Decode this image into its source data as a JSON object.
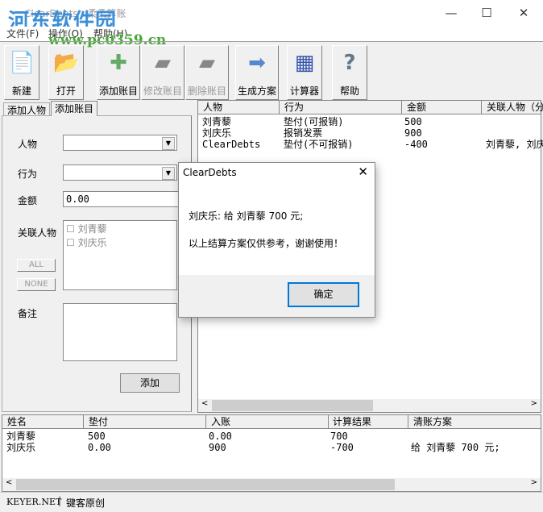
{
  "window": {
    "title": "ClearDebts - 柔柔算账",
    "watermark": "河东软件园",
    "watermark_url": "www.pc0359.cn"
  },
  "menu": [
    "文件(F)",
    "操作(O)",
    "帮助(H)"
  ],
  "toolbar": [
    {
      "label": "新建",
      "icon": "new-file-icon",
      "enabled": true
    },
    {
      "label": "打开",
      "icon": "open-folder-icon",
      "enabled": true
    },
    {
      "label": "添加账目",
      "icon": "add-entry-icon",
      "enabled": true
    },
    {
      "label": "修改账目",
      "icon": "edit-entry-icon",
      "enabled": false
    },
    {
      "label": "删除账目",
      "icon": "delete-entry-icon",
      "enabled": false
    },
    {
      "label": "生成方案",
      "icon": "generate-plan-icon",
      "enabled": true
    },
    {
      "label": "计算器",
      "icon": "calculator-icon",
      "enabled": true
    },
    {
      "label": "帮助",
      "icon": "help-icon",
      "enabled": true
    }
  ],
  "tabs": [
    "添加人物",
    "添加账目"
  ],
  "form": {
    "person_label": "人物",
    "action_label": "行为",
    "amount_label": "金额",
    "amount_value": "0.00",
    "related_label": "关联人物",
    "related_people": [
      "刘青藜",
      "刘庆乐"
    ],
    "all_btn": "ALL",
    "none_btn": "NONE",
    "note_label": "备注",
    "add_btn": "添加"
  },
  "entries": {
    "headers": [
      "人物",
      "行为",
      "金额",
      "关联人物（分"
    ],
    "rows": [
      [
        "刘青藜",
        "垫付(可报销)",
        "500",
        ""
      ],
      [
        "刘庆乐",
        "报销发票",
        "900",
        ""
      ],
      [
        "ClearDebts",
        "垫付(不可报销)",
        "-400",
        "刘青藜, 刘庆"
      ]
    ]
  },
  "results": {
    "headers": [
      "姓名",
      "垫付",
      "入账",
      "计算结果",
      "清账方案"
    ],
    "rows": [
      [
        "刘青藜",
        "500",
        "0.00",
        "700",
        ""
      ],
      [
        "刘庆乐",
        "0.00",
        "900",
        "-700",
        "给 刘青藜 700 元;"
      ]
    ]
  },
  "status": {
    "left": "KEYER.NET",
    "right": "键客原创"
  },
  "dialog": {
    "title": "ClearDebts",
    "line1": "刘庆乐: 给 刘青藜 700 元;",
    "line2": "以上结算方案仅供参考，谢谢使用！",
    "ok": "确定"
  }
}
